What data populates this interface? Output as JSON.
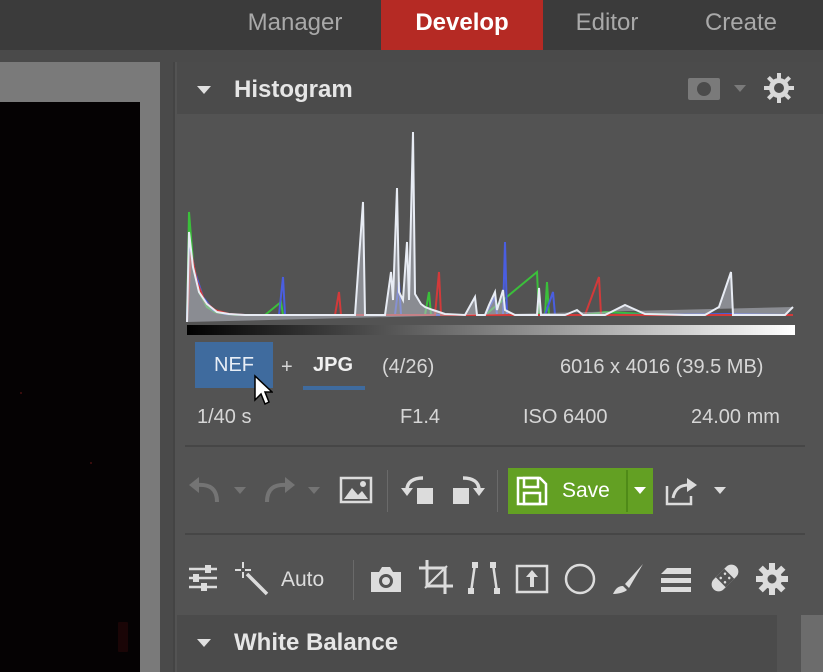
{
  "nav": {
    "tabs": [
      {
        "label": "Manager"
      },
      {
        "label": "Develop"
      },
      {
        "label": "Editor"
      },
      {
        "label": "Create"
      }
    ],
    "active": "Develop"
  },
  "histogram": {
    "title": "Histogram"
  },
  "file_info": {
    "raw_format": "NEF",
    "plus": "+",
    "jpg_format": "JPG",
    "index": "(4/26)",
    "dimensions": "6016 x 4016 (39.5 MB)",
    "shutter": "1/40 s",
    "aperture": "F1.4",
    "iso": "ISO 6400",
    "focal_length": "24.00 mm"
  },
  "toolbar": {
    "save_label": "Save"
  },
  "tools": {
    "auto_label": "Auto"
  },
  "white_balance": {
    "title": "White Balance"
  },
  "colors": {
    "active_tab": "#b52a24",
    "save_button": "#63a023",
    "selection": "#3f6b9e"
  }
}
